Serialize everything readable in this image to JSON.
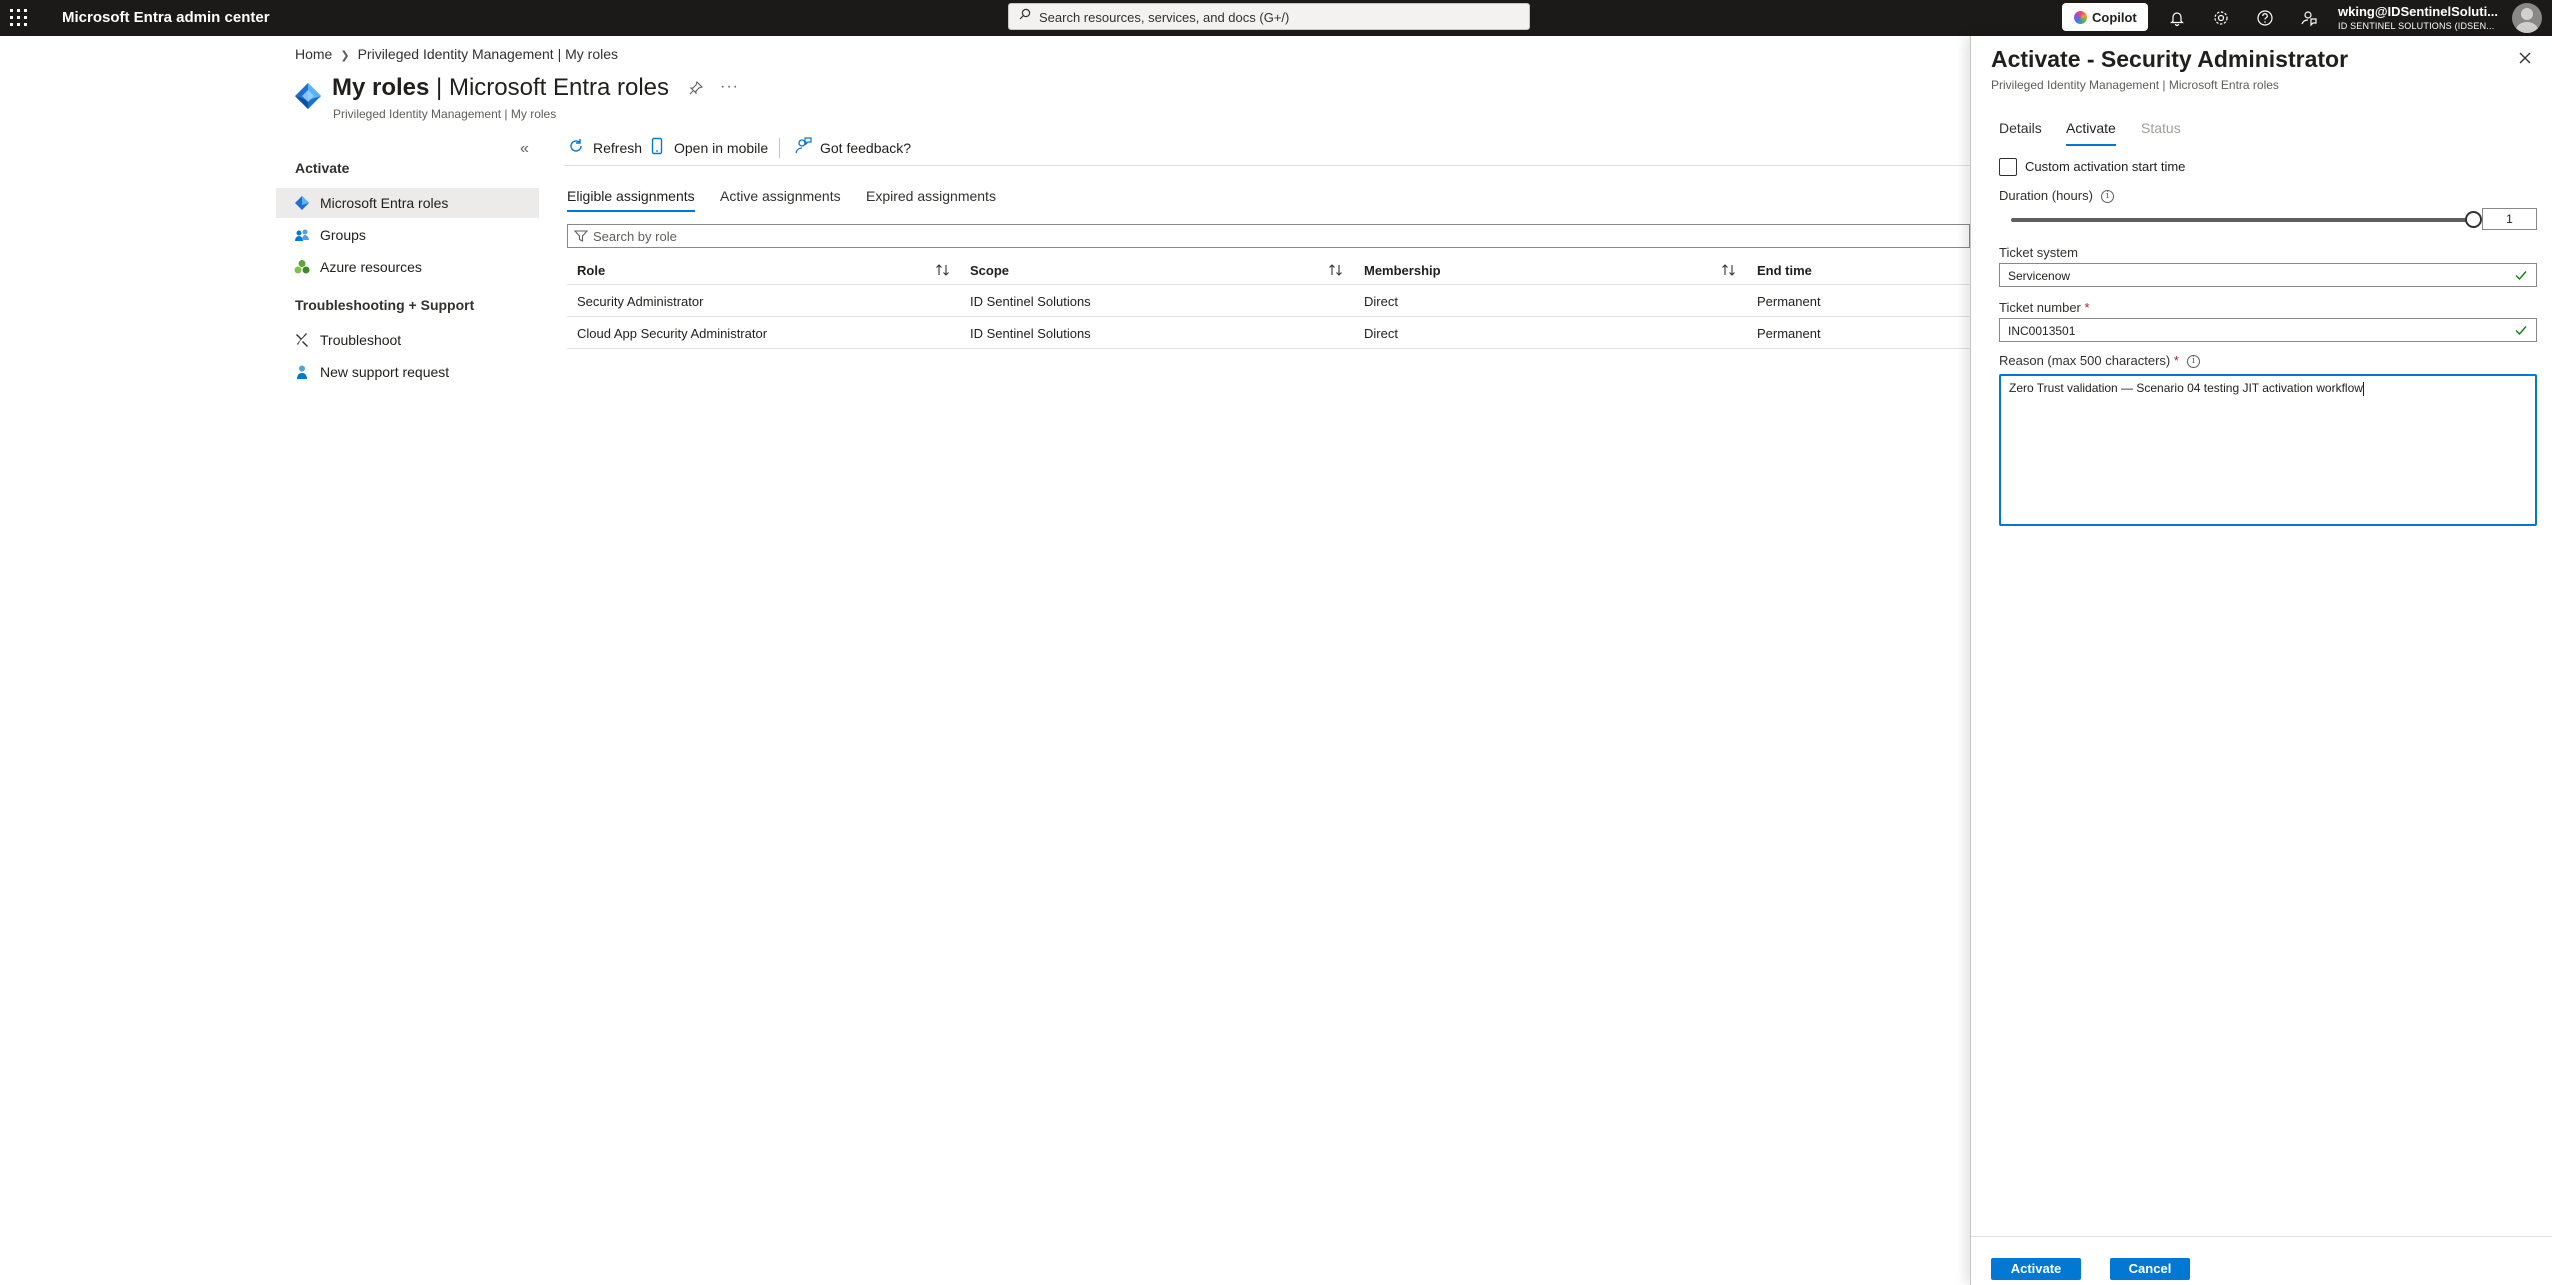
{
  "topbar": {
    "app_title": "Microsoft Entra admin center",
    "search_placeholder": "Search resources, services, and docs (G+/)",
    "copilot_label": "Copilot",
    "account_name": "wking@IDSentinelSoluti...",
    "account_tenant": "ID SENTINEL SOLUTIONS (IDSEN..."
  },
  "breadcrumb": {
    "home": "Home",
    "current": "Privileged Identity Management | My roles"
  },
  "header": {
    "title_bold": "My roles",
    "title_rest": " | Microsoft Entra roles",
    "subtitle": "Privileged Identity Management | My roles"
  },
  "nav": {
    "collapse_glyph": "«",
    "section_activate": "Activate",
    "items_activate": [
      {
        "label": "Microsoft Entra roles",
        "icon": "entra-diamond-icon"
      },
      {
        "label": "Groups",
        "icon": "groups-icon"
      },
      {
        "label": "Azure resources",
        "icon": "azure-resources-icon"
      }
    ],
    "section_support": "Troubleshooting + Support",
    "items_support": [
      {
        "label": "Troubleshoot",
        "icon": "troubleshoot-icon"
      },
      {
        "label": "New support request",
        "icon": "support-request-icon"
      }
    ]
  },
  "commands": {
    "refresh": "Refresh",
    "open_mobile": "Open in mobile",
    "feedback": "Got feedback?"
  },
  "tabs": {
    "eligible": "Eligible assignments",
    "active": "Active assignments",
    "expired": "Expired assignments"
  },
  "filter_placeholder": "Search by role",
  "table": {
    "headers": {
      "role": "Role",
      "scope": "Scope",
      "membership": "Membership",
      "end_time": "End time"
    },
    "rows": [
      {
        "role": "Security Administrator",
        "scope": "ID Sentinel Solutions",
        "membership": "Direct",
        "end_time": "Permanent"
      },
      {
        "role": "Cloud App Security Administrator",
        "scope": "ID Sentinel Solutions",
        "membership": "Direct",
        "end_time": "Permanent"
      }
    ]
  },
  "panel": {
    "title": "Activate - Security Administrator",
    "subtitle": "Privileged Identity Management | Microsoft Entra roles",
    "tabs": {
      "details": "Details",
      "activate": "Activate",
      "status": "Status"
    },
    "custom_start_label": "Custom activation start time",
    "custom_start_checked": false,
    "duration_label": "Duration (hours)",
    "duration_value": "1",
    "ticket_system_label": "Ticket system",
    "ticket_system_value": "Servicenow",
    "ticket_number_label": "Ticket number",
    "ticket_number_value": "INC0013501",
    "reason_label": "Reason (max 500 characters)",
    "reason_value": "Zero Trust validation — Scenario 04 testing JIT activation workflow",
    "required_marker": "*",
    "info_glyph": "i",
    "activate_button": "Activate",
    "cancel_button": "Cancel"
  },
  "colors": {
    "accent": "#0078d4",
    "topbar": "#1b1a19",
    "valid": "#107c10",
    "required": "#a4262c"
  }
}
